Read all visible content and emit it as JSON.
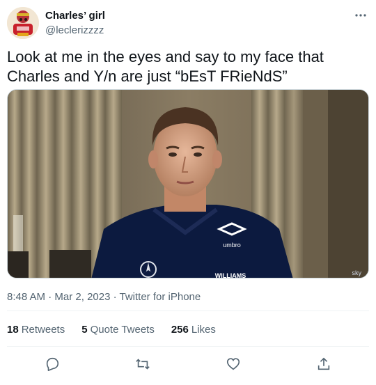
{
  "author": {
    "display_name": "Charles’ girl",
    "handle": "@leclerizzzz"
  },
  "tweet": {
    "text": "Look at me in the eyes and say to my face that Charles and Y/n are just “bEsT FRieNdS”"
  },
  "media": {
    "shirt_brand": "umbro",
    "shirt_sponsor": "WILLIAMS",
    "corner_logo": "sky"
  },
  "meta": {
    "time": "8:48 AM",
    "date": "Mar 2, 2023",
    "source": "Twitter for iPhone",
    "separator": " · "
  },
  "stats": {
    "retweets_count": "18",
    "retweets_label": "Retweets",
    "quotes_count": "5",
    "quotes_label": "Quote Tweets",
    "likes_count": "256",
    "likes_label": "Likes"
  },
  "colors": {
    "text_primary": "#0f1419",
    "text_secondary": "#536471",
    "divider": "#eff3f4"
  },
  "icons": {
    "more": "more-dots-icon",
    "reply": "reply-icon",
    "retweet": "retweet-icon",
    "like": "heart-icon",
    "share": "share-icon"
  }
}
